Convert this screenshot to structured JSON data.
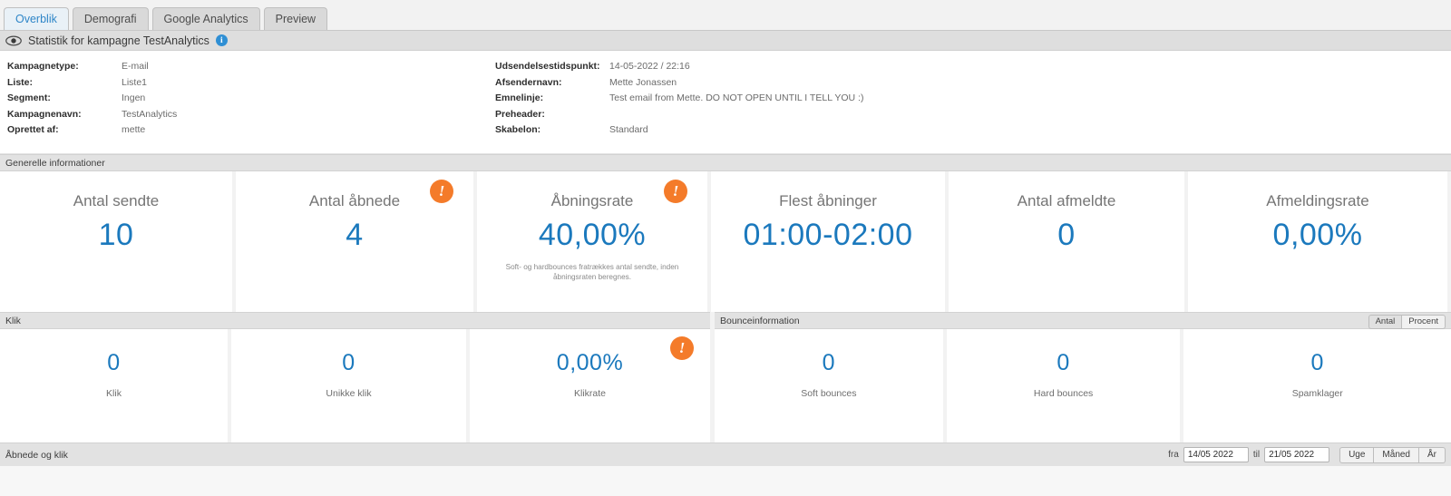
{
  "tabs": [
    {
      "label": "Overblik",
      "active": true
    },
    {
      "label": "Demografi",
      "active": false
    },
    {
      "label": "Google Analytics",
      "active": false
    },
    {
      "label": "Preview",
      "active": false
    }
  ],
  "titlebar": {
    "title": "Statistik for kampagne TestAnalytics",
    "info_badge": "i",
    "eye_icon": "eye-icon"
  },
  "meta": {
    "left": [
      {
        "key": "Kampagnetype:",
        "value": "E-mail"
      },
      {
        "key": "Liste:",
        "value": "Liste1"
      },
      {
        "key": "Segment:",
        "value": "Ingen"
      },
      {
        "key": "Kampagnenavn:",
        "value": "TestAnalytics"
      },
      {
        "key": "Oprettet af:",
        "value": "mette"
      }
    ],
    "right": [
      {
        "key": "Udsendelsestidspunkt:",
        "value": "14-05-2022 / 22:16"
      },
      {
        "key": "Afsendernavn:",
        "value": "Mette Jonassen"
      },
      {
        "key": "Emnelinje:",
        "value": "Test email from Mette. DO NOT OPEN UNTIL I TELL YOU :)"
      },
      {
        "key": "Preheader:",
        "value": ""
      },
      {
        "key": "Skabelon:",
        "value": "Standard"
      }
    ]
  },
  "general": {
    "header": "Generelle informationer",
    "cards": [
      {
        "label": "Antal sendte",
        "value": "10",
        "note": "",
        "alert": false
      },
      {
        "label": "Antal åbnede",
        "value": "4",
        "note": "",
        "alert": true
      },
      {
        "label": "Åbningsrate",
        "value": "40,00%",
        "note": "Soft- og hardbounces fratrækkes antal sendte, inden åbningsraten beregnes.",
        "alert": true
      },
      {
        "label": "Flest åbninger",
        "value": "01:00-02:00",
        "note": "",
        "alert": false
      },
      {
        "label": "Antal afmeldte",
        "value": "0",
        "note": "",
        "alert": false
      },
      {
        "label": "Afmeldingsrate",
        "value": "0,00%",
        "note": "",
        "alert": false
      }
    ]
  },
  "klik": {
    "header": "Klik",
    "cards": [
      {
        "value": "0",
        "label": "Klik",
        "alert": false
      },
      {
        "value": "0",
        "label": "Unikke klik",
        "alert": false
      },
      {
        "value": "0,00%",
        "label": "Klikrate",
        "alert": true
      }
    ]
  },
  "bounce": {
    "header": "Bounceinformation",
    "toggle": [
      {
        "label": "Antal",
        "active": true
      },
      {
        "label": "Procent",
        "active": false
      }
    ],
    "cards": [
      {
        "value": "0",
        "label": "Soft bounces"
      },
      {
        "value": "0",
        "label": "Hard bounces"
      },
      {
        "value": "0",
        "label": "Spamklager"
      }
    ]
  },
  "bottom": {
    "header": "Åbnede og klik",
    "from_label": "fra",
    "from_value": "14/05 2022",
    "to_label": "til",
    "to_value": "21/05 2022",
    "periods": [
      {
        "label": "Uge"
      },
      {
        "label": "Måned"
      },
      {
        "label": "År"
      }
    ]
  },
  "colors": {
    "accent_blue": "#1b79bd",
    "alert_orange": "#f47b2a",
    "info_blue": "#2f8fd4",
    "tab_active_text": "#2f86c8"
  }
}
